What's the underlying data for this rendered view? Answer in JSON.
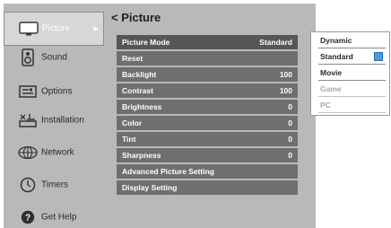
{
  "sidebar": {
    "items": [
      {
        "label": "Picture",
        "icon": "tv-icon"
      },
      {
        "label": "Sound",
        "icon": "speaker-icon"
      },
      {
        "label": "Options",
        "icon": "options-icon"
      },
      {
        "label": "Installation",
        "icon": "satellite-icon"
      },
      {
        "label": "Network",
        "icon": "globe-icon"
      },
      {
        "label": "Timers",
        "icon": "timer-icon"
      },
      {
        "label": "Get Help",
        "icon": "help-icon"
      }
    ],
    "active_arrow": "▶"
  },
  "main": {
    "title": "< Picture",
    "rows": [
      {
        "label": "Picture  Mode",
        "value": "Standard"
      },
      {
        "label": "Reset",
        "value": ""
      },
      {
        "label": "Backlight",
        "value": "100"
      },
      {
        "label": "Contrast",
        "value": "100"
      },
      {
        "label": "Brightness",
        "value": "0"
      },
      {
        "label": "Color",
        "value": "0"
      },
      {
        "label": "Tint",
        "value": "0"
      },
      {
        "label": "Sharpness",
        "value": "0"
      },
      {
        "label": "Advanced Picture Setting",
        "value": ""
      },
      {
        "label": "Display Setting",
        "value": ""
      }
    ]
  },
  "dropdown": {
    "options": [
      {
        "label": "Dynamic"
      },
      {
        "label": "Standard"
      },
      {
        "label": "Movie"
      },
      {
        "label": "Game"
      },
      {
        "label": "PC"
      }
    ]
  },
  "colors": {
    "panel": "#b9b9b9",
    "row": "#6f6f6f",
    "selected_row": "#565656",
    "check_accent": "#4d9bd9"
  }
}
